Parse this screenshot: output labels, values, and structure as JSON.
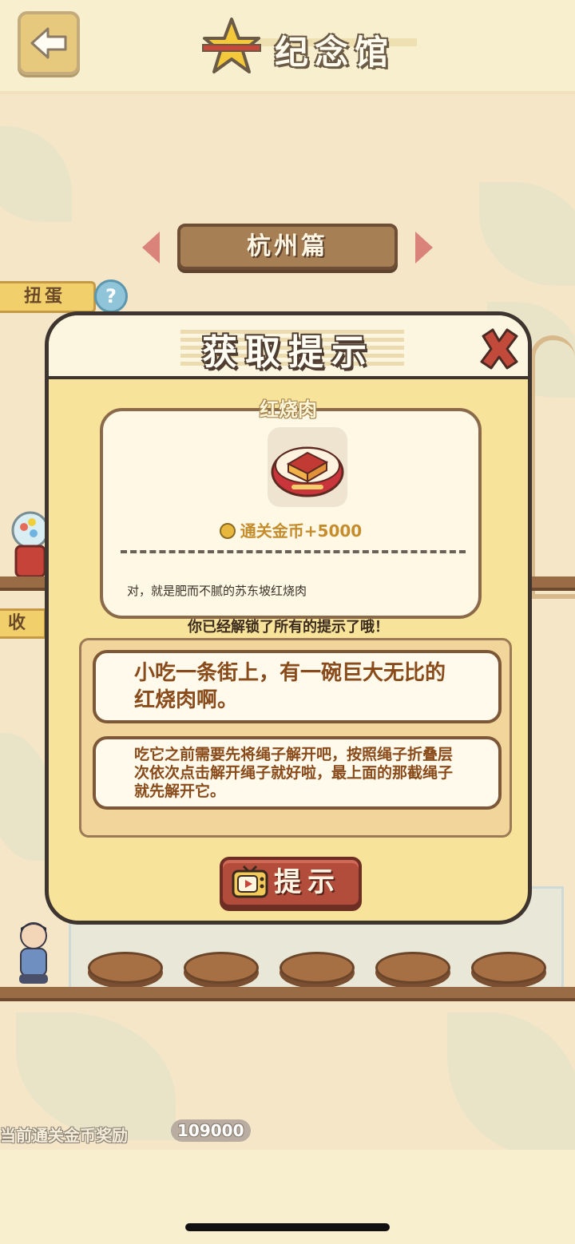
{
  "header": {
    "title": "纪念馆"
  },
  "museum": {
    "chapter": "杭州篇",
    "gacha_label": "扭蛋",
    "collection_label": "收",
    "reward_label": "当前通关金币奖励",
    "reward_value": "109000"
  },
  "modal": {
    "title": "获取提示",
    "item_name": "红烧肉",
    "coin_reward": "通关金币+5000",
    "description": "对，就是肥而不腻的苏东坡红烧肉",
    "unlocked_message": "你已经解锁了所有的提示了哦！",
    "tips": [
      "小吃一条街上，有一碗巨大无比的红烧肉啊。",
      "吃它之前需要先将绳子解开吧，按照绳子折叠层次依次点击解开绳子就好啦，最上面的那截绳子就先解开它。"
    ],
    "hint_button": "提示"
  },
  "icons": {
    "back": "back-arrow-icon",
    "star": "star-icon",
    "close": "close-x-icon",
    "help": "question-mark-icon",
    "coin": "coin-icon",
    "video": "tv-video-icon"
  },
  "colors": {
    "modal_bg": "#f8e39a",
    "accent_red": "#b24d3c",
    "tip_text": "#8a4b1b",
    "coin_text": "#c58c2d"
  }
}
